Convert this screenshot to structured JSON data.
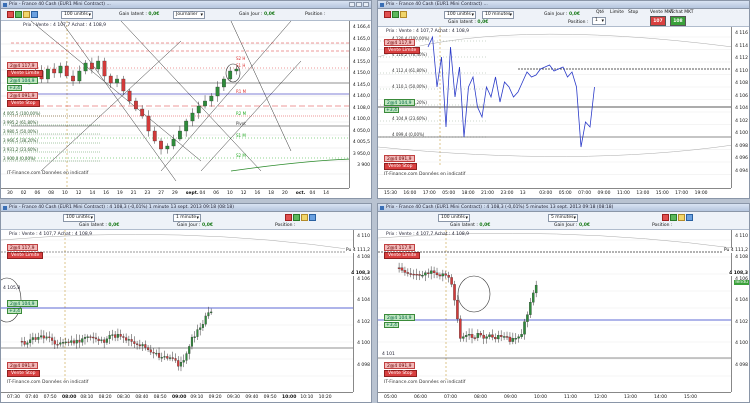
{
  "panel_top_left": {
    "title": "Prix - France 40 Cash (EUR1 Mini Contract) ...",
    "units": "100 unités",
    "gain_label": "Gain latent :",
    "gain_value": "0,0€",
    "period": "Journalier",
    "gain_jour_label": "Gain Jour :",
    "gain_jour_value": "0,0€",
    "position_label": "Position :",
    "info": "Prix : Vente : 4 107,7 Achat : 4 108,9",
    "tag_limit": "2@4 117,9",
    "btn_limit": "Vente Limite",
    "tag_stop_value": "2@4 104,9",
    "plus_value": "+3,4",
    "btn_stop": "Vente Stop",
    "tag_stop2": "2@4 091,9",
    "footer": "IT-Finance.com Données en indicatif",
    "y_ticks": [
      "4 166,4",
      "4 165,0",
      "4 160,0",
      "4 155,0",
      "4 150,0",
      "4 145,0",
      "4 140,0",
      "4 108,0",
      "4 100,0",
      "4 050,0",
      "4 005,5",
      "3 950,0",
      "3 900"
    ],
    "x_ticks": [
      "30",
      "02",
      "06",
      "08",
      "10",
      "12",
      "14",
      "16",
      "19",
      "21",
      "23",
      "27",
      "29",
      "sept.",
      "04",
      "06",
      "10",
      "12",
      "16",
      "18",
      "20",
      "oct.",
      "04",
      "14"
    ],
    "x_bold": [
      "août",
      "sept.",
      "oct."
    ],
    "levels": [
      "4 005,5 (100,00%)",
      "3 995,2 (61,80%)",
      "3 980,5 (50,00%)",
      "3 966,5 (38,20%)",
      "3 931,2 (23,60%)",
      "3 900,0 (0,00%)"
    ],
    "right_labels": [
      "S2 H",
      "S1 H",
      "R1 M",
      "R2 M",
      "S1 M",
      "S2 M",
      "Pivot"
    ]
  },
  "panel_top_right": {
    "title": "Prix - France 40 Cash (EUR1 Mini Contract) ...",
    "units": "100 unités",
    "period": "10 minutes",
    "gain_label": "Gain latent :",
    "gain_value": "0,0€",
    "gain_jour_label": "Gain Jour :",
    "gain_jour_value": "0,0€",
    "position_label": "Position :",
    "qty_label": "Qté",
    "qty_value": "1",
    "limite_label": "Limite",
    "stop_label": "Stop",
    "sell_label": "Vente MKT",
    "sell_price": "107",
    "buy_label": "Achat MKT",
    "buy_price": "108",
    "info": "Prix : Vente : 4 107,7 Achat : 4 108,9",
    "tag_limit": "2@4 117,9",
    "btn_limit": "Vente Limite",
    "tag_stop_value": "2@4 104,9",
    "plus_value": "+3,4",
    "btn_stop": "Vente Stop",
    "tag_stop2": "2@4 091,9",
    "footer": "IT-Finance.com Données en indicatif",
    "y_ticks": [
      "4 116",
      "4 114",
      "4 112",
      "4 110",
      "4 108",
      "4 106",
      "4 104",
      "4 102",
      "4 100",
      "4 098",
      "4 096",
      "4 094"
    ],
    "x_ticks": [
      "15:30",
      "16:00",
      "17:00",
      "05:00",
      "18:00",
      "21:00",
      "23:00",
      "13",
      "03:00",
      "05:00",
      "07:00",
      "09:00",
      "11:00",
      "13:00",
      "15:00",
      "17:00",
      "19:00"
    ],
    "levels": [
      "4 120,4 (100,00%)",
      "4 116,2 (76,40%)",
      "4 112,4 (61,80%)",
      "4 110,1 (50,00%)",
      "4 107,8 (38,20%)",
      "4 104,9 (23,60%)",
      "4 099,4 (0,00%)"
    ]
  },
  "panel_bottom_left": {
    "title": "Prix - France 40 Cash (EUR1 Mini Contract) : 4 108,3 (-0,01%) 1 minute 13 sept. 2013 09:18 (08:18)",
    "units": "100 unités",
    "period": "1 minute",
    "gain_label": "Gain latent :",
    "gain_value": "0,0€",
    "gain_jour_label": "Gain Jour :",
    "gain_jour_value": "0,0€",
    "position_label": "Position :",
    "info": "Prix : Vente : 4 107,7 Achat : 4 108,9",
    "tag_limit": "2@4 117,9",
    "btn_limit": "Vente Limite",
    "tag_stop_value": "2@4 104,9",
    "plus_value": "+3,4",
    "btn_stop": "Vente Stop",
    "tag_stop2": "2@4 091,9",
    "left_level": "4 105,8",
    "footer": "IT-Finance.com Données en indicatif",
    "y_ticks": [
      "4 110",
      "4 108",
      "4 106",
      "4 104",
      "4 102",
      "4 100",
      "4 098"
    ],
    "x_ticks": [
      "07:30",
      "07:40",
      "07:50",
      "08:00",
      "08:10",
      "08:20",
      "08:30",
      "08:40",
      "08:50",
      "09:00",
      "09:10",
      "09:20",
      "09:30",
      "09:40",
      "09:50",
      "10:00",
      "10:10",
      "10:20"
    ],
    "x_bold": [
      "08:00",
      "09:00",
      "10:00"
    ],
    "pu_label": "Pu",
    "pu_value": "4 111,2",
    "price_label": "4 108,3"
  },
  "panel_bottom_right": {
    "title": "Prix - France 40 Cash (EUR1 Mini Contract) : 4 108,3 (-0,01%) 5 minutes 13 sept. 2013 09:18 (08:18)",
    "units": "100 unités",
    "period": "5 minutes",
    "gain_label": "Gain latent :",
    "gain_value": "0,0€",
    "gain_jour_label": "Gain Jour :",
    "gain_jour_value": "0,0€",
    "position_label": "Position :",
    "info": "Prix : Vente : 4 107,7 Achat : 4 108,9",
    "tag_limit": "2@4 117,9",
    "btn_limit": "Vente Limite",
    "tag_stop_value": "2@4 104,9",
    "plus_value": "+3,4",
    "btn_stop": "Vente Stop",
    "tag_stop2": "2@4 091,9",
    "left_level": "4 101",
    "footer": "IT-Finance.com Données en indicatif",
    "y_ticks": [
      "4 110",
      "4 108",
      "4 106",
      "4 104",
      "4 102",
      "4 100",
      "4 098"
    ],
    "x_ticks": [
      "05:00",
      "06:00",
      "07:00",
      "08:00",
      "09:00",
      "10:00",
      "11:00",
      "12:00",
      "13:00",
      "14:00",
      "15:00"
    ],
    "x_bold": [],
    "pu_label": "Pu",
    "pu_value": "4 111,2",
    "price_label": "4 108,3",
    "cur_tag": "Tendu"
  }
}
